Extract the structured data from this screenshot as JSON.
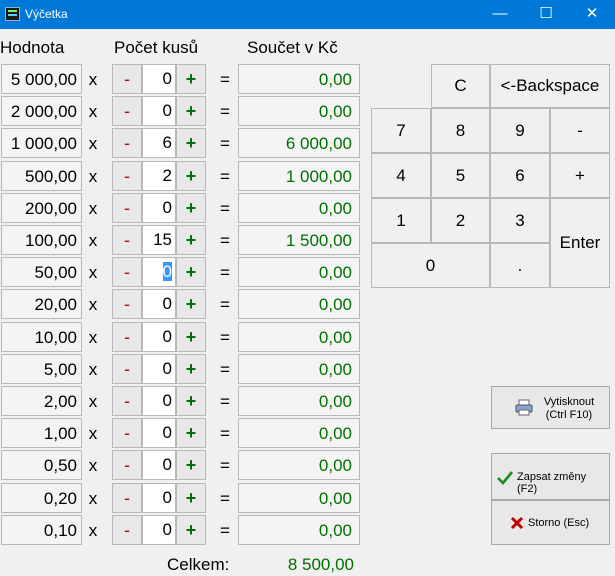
{
  "window": {
    "title": "Výčetka",
    "minimize": "—",
    "maximize": "☐",
    "close": "✕"
  },
  "headers": {
    "value": "Hodnota",
    "count": "Počet kusů",
    "sum": "Součet v Kč"
  },
  "row_symbols": {
    "times": "x",
    "minus": "-",
    "plus": "+",
    "equals": "="
  },
  "rows": [
    {
      "value": "5 000,00",
      "qty": "0",
      "sum": "0,00"
    },
    {
      "value": "2 000,00",
      "qty": "0",
      "sum": "0,00"
    },
    {
      "value": "1 000,00",
      "qty": "6",
      "sum": "6 000,00"
    },
    {
      "value": "500,00",
      "qty": "2",
      "sum": "1 000,00"
    },
    {
      "value": "200,00",
      "qty": "0",
      "sum": "0,00"
    },
    {
      "value": "100,00",
      "qty": "15",
      "sum": "1 500,00"
    },
    {
      "value": "50,00",
      "qty": "0",
      "sum": "0,00",
      "selected": true
    },
    {
      "value": "20,00",
      "qty": "0",
      "sum": "0,00"
    },
    {
      "value": "10,00",
      "qty": "0",
      "sum": "0,00"
    },
    {
      "value": "5,00",
      "qty": "0",
      "sum": "0,00"
    },
    {
      "value": "2,00",
      "qty": "0",
      "sum": "0,00"
    },
    {
      "value": "1,00",
      "qty": "0",
      "sum": "0,00"
    },
    {
      "value": "0,50",
      "qty": "0",
      "sum": "0,00"
    },
    {
      "value": "0,20",
      "qty": "0",
      "sum": "0,00"
    },
    {
      "value": "0,10",
      "qty": "0",
      "sum": "0,00"
    }
  ],
  "total": {
    "label": "Celkem:",
    "value": "8 500,00"
  },
  "keypad": [
    {
      "key": "C",
      "name": "clear"
    },
    {
      "key": "<-Backspace",
      "name": "backspace"
    },
    {
      "key": "7",
      "name": "7"
    },
    {
      "key": "8",
      "name": "8"
    },
    {
      "key": "9",
      "name": "9"
    },
    {
      "key": "-",
      "name": "minus"
    },
    {
      "key": "4",
      "name": "4"
    },
    {
      "key": "5",
      "name": "5"
    },
    {
      "key": "6",
      "name": "6"
    },
    {
      "key": "+",
      "name": "plus"
    },
    {
      "key": "1",
      "name": "1"
    },
    {
      "key": "2",
      "name": "2"
    },
    {
      "key": "3",
      "name": "3"
    },
    {
      "key": "Enter",
      "name": "enter"
    },
    {
      "key": "0",
      "name": "0"
    },
    {
      "key": ".",
      "name": "decimal"
    }
  ],
  "actions": {
    "print": {
      "line1": "Vytisknout",
      "line2": "(Ctrl F10)",
      "icon": "printer-icon"
    },
    "save": {
      "label": "Zapsat změny (F2)",
      "icon": "checkmark-icon"
    },
    "cancel": {
      "label": "Storno (Esc)",
      "icon": "x-mark-icon"
    }
  },
  "colors": {
    "titlebar": "#0078d7",
    "minus": "#d40000",
    "plus": "#007000",
    "sum": "#007000",
    "selection": "#3399ff"
  }
}
